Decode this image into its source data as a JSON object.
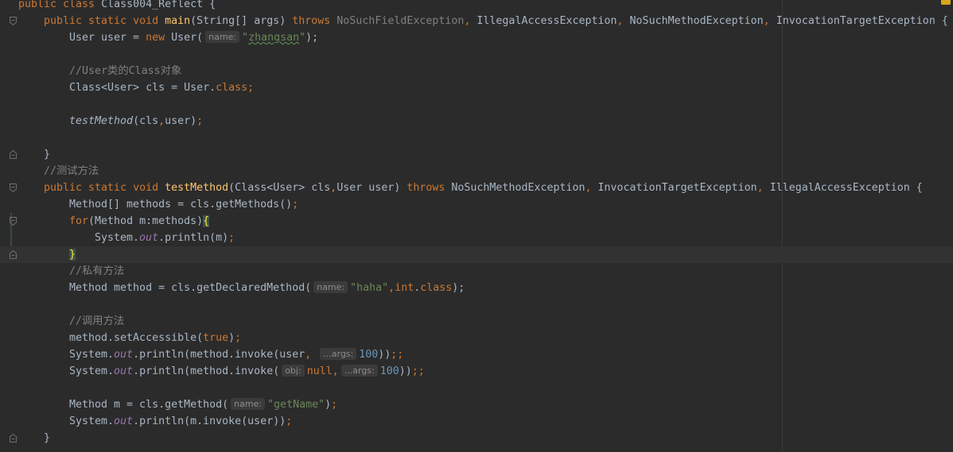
{
  "editor": {
    "language": "java",
    "theme": "darcula",
    "colors": {
      "background": "#2b2b2b",
      "keyword": "#cc7832",
      "string": "#6a8759",
      "number": "#6897bb",
      "comment": "#808080",
      "method_declaration": "#ffc66d",
      "static_field": "#9876aa",
      "plain": "#a9b7c6",
      "matched_brace": "#ffef28"
    },
    "lines": [
      {
        "indent": 0,
        "fold": "none",
        "tokens": [
          {
            "t": "public class ",
            "c": "kw"
          },
          {
            "t": "Class004_Reflect {",
            "c": "plain"
          }
        ]
      },
      {
        "indent": 1,
        "fold": "open",
        "tokens": [
          {
            "t": "public static void ",
            "c": "kw"
          },
          {
            "t": "main",
            "c": "fn"
          },
          {
            "t": "(String[] args) ",
            "c": "plain"
          },
          {
            "t": "throws ",
            "c": "kw"
          },
          {
            "t": "NoSuchFieldException",
            "c": "unused"
          },
          {
            "t": ", ",
            "c": "kw"
          },
          {
            "t": "IllegalAccessException",
            "c": "plain"
          },
          {
            "t": ", ",
            "c": "kw"
          },
          {
            "t": "NoSuchMethodException",
            "c": "plain"
          },
          {
            "t": ", ",
            "c": "kw"
          },
          {
            "t": "InvocationTargetException {",
            "c": "plain"
          }
        ]
      },
      {
        "indent": 2,
        "fold": "none",
        "tokens": [
          {
            "t": "User user = ",
            "c": "plain"
          },
          {
            "t": "new ",
            "c": "kw"
          },
          {
            "t": "User(",
            "c": "plain"
          },
          {
            "t": "name:",
            "c": "hint"
          },
          {
            "t": "\"",
            "c": "str"
          },
          {
            "t": "zhangsan",
            "c": "str-warn"
          },
          {
            "t": "\"",
            "c": "str"
          },
          {
            "t": ");",
            "c": "plain"
          }
        ]
      },
      {
        "indent": 0,
        "fold": "none",
        "tokens": []
      },
      {
        "indent": 2,
        "fold": "none",
        "tokens": [
          {
            "t": "//User类的Class对象",
            "c": "cmt"
          }
        ]
      },
      {
        "indent": 2,
        "fold": "none",
        "tokens": [
          {
            "t": "Class<User> cls = User.",
            "c": "plain"
          },
          {
            "t": "class;",
            "c": "kw"
          }
        ]
      },
      {
        "indent": 0,
        "fold": "none",
        "tokens": []
      },
      {
        "indent": 2,
        "fold": "none",
        "tokens": [
          {
            "t": "testMethod",
            "c": "static"
          },
          {
            "t": "(cls",
            "c": "plain"
          },
          {
            "t": ",",
            "c": "kw"
          },
          {
            "t": "user)",
            "c": "plain"
          },
          {
            "t": ";",
            "c": "kw"
          }
        ]
      },
      {
        "indent": 0,
        "fold": "none",
        "tokens": []
      },
      {
        "indent": 1,
        "fold": "close",
        "tokens": [
          {
            "t": "}",
            "c": "plain"
          }
        ]
      },
      {
        "indent": 1,
        "fold": "none",
        "tokens": [
          {
            "t": "//测试方法",
            "c": "cmt"
          }
        ]
      },
      {
        "indent": 1,
        "fold": "open",
        "tokens": [
          {
            "t": "public static void ",
            "c": "kw"
          },
          {
            "t": "testMethod",
            "c": "fn"
          },
          {
            "t": "(Class<User> cls",
            "c": "plain"
          },
          {
            "t": ",",
            "c": "kw"
          },
          {
            "t": "User user) ",
            "c": "plain"
          },
          {
            "t": "throws ",
            "c": "kw"
          },
          {
            "t": "NoSuchMethodException",
            "c": "plain"
          },
          {
            "t": ", ",
            "c": "kw"
          },
          {
            "t": "InvocationTargetException",
            "c": "plain"
          },
          {
            "t": ", ",
            "c": "kw"
          },
          {
            "t": "IllegalAccessException {",
            "c": "plain"
          }
        ]
      },
      {
        "indent": 2,
        "fold": "none",
        "tokens": [
          {
            "t": "Method[] methods = cls.getMethods()",
            "c": "plain"
          },
          {
            "t": ";",
            "c": "kw"
          }
        ]
      },
      {
        "indent": 2,
        "fold": "open",
        "tokens": [
          {
            "t": "for",
            "c": "kw"
          },
          {
            "t": "(Method m:methods)",
            "c": "plain"
          },
          {
            "t": "{",
            "c": "brace"
          }
        ]
      },
      {
        "indent": 3,
        "fold": "none",
        "tokens": [
          {
            "t": "System.",
            "c": "plain"
          },
          {
            "t": "out",
            "c": "field"
          },
          {
            "t": ".println(m)",
            "c": "plain"
          },
          {
            "t": ";",
            "c": "kw"
          }
        ]
      },
      {
        "indent": 2,
        "fold": "close",
        "current": true,
        "tokens": [
          {
            "t": "}",
            "c": "brace"
          }
        ]
      },
      {
        "indent": 2,
        "fold": "none",
        "tokens": [
          {
            "t": "//私有方法",
            "c": "cmt"
          }
        ]
      },
      {
        "indent": 2,
        "fold": "none",
        "tokens": [
          {
            "t": "Method method = cls.getDeclaredMethod(",
            "c": "plain"
          },
          {
            "t": "name:",
            "c": "hint"
          },
          {
            "t": "\"haha\"",
            "c": "str"
          },
          {
            "t": ",",
            "c": "kw"
          },
          {
            "t": "int",
            "c": "kw"
          },
          {
            "t": ".",
            "c": "plain"
          },
          {
            "t": "class",
            "c": "kw"
          },
          {
            "t": ");",
            "c": "plain"
          }
        ]
      },
      {
        "indent": 0,
        "fold": "none",
        "tokens": []
      },
      {
        "indent": 2,
        "fold": "none",
        "tokens": [
          {
            "t": "//调用方法",
            "c": "cmt"
          }
        ]
      },
      {
        "indent": 2,
        "fold": "none",
        "tokens": [
          {
            "t": "method.setAccessible(",
            "c": "plain"
          },
          {
            "t": "true",
            "c": "kw"
          },
          {
            "t": ")",
            "c": "plain"
          },
          {
            "t": ";",
            "c": "kw"
          }
        ]
      },
      {
        "indent": 2,
        "fold": "none",
        "tokens": [
          {
            "t": "System.",
            "c": "plain"
          },
          {
            "t": "out",
            "c": "field"
          },
          {
            "t": ".println(method.invoke(user",
            "c": "plain"
          },
          {
            "t": ",",
            "c": "kw"
          },
          {
            "t": " ",
            "c": "plain"
          },
          {
            "t": "...args:",
            "c": "hint"
          },
          {
            "t": "100",
            "c": "num"
          },
          {
            "t": "))",
            "c": "plain"
          },
          {
            "t": ";;",
            "c": "kw"
          }
        ]
      },
      {
        "indent": 2,
        "fold": "none",
        "tokens": [
          {
            "t": "System.",
            "c": "plain"
          },
          {
            "t": "out",
            "c": "field"
          },
          {
            "t": ".println(method.invoke(",
            "c": "plain"
          },
          {
            "t": "obj:",
            "c": "hint"
          },
          {
            "t": "null",
            "c": "kw"
          },
          {
            "t": ",",
            "c": "kw"
          },
          {
            "t": "...args:",
            "c": "hint"
          },
          {
            "t": "100",
            "c": "num"
          },
          {
            "t": "))",
            "c": "plain"
          },
          {
            "t": ";;",
            "c": "kw"
          }
        ]
      },
      {
        "indent": 0,
        "fold": "none",
        "tokens": []
      },
      {
        "indent": 2,
        "fold": "none",
        "tokens": [
          {
            "t": "Method m = cls.getMethod(",
            "c": "plain"
          },
          {
            "t": "name:",
            "c": "hint"
          },
          {
            "t": "\"getName\"",
            "c": "str"
          },
          {
            "t": ")",
            "c": "plain"
          },
          {
            "t": ";",
            "c": "kw"
          }
        ]
      },
      {
        "indent": 2,
        "fold": "none",
        "tokens": [
          {
            "t": "System.",
            "c": "plain"
          },
          {
            "t": "out",
            "c": "field"
          },
          {
            "t": ".println(m.invoke(user))",
            "c": "plain"
          },
          {
            "t": ";",
            "c": "kw"
          }
        ]
      },
      {
        "indent": 1,
        "fold": "close",
        "tokens": [
          {
            "t": "}",
            "c": "plain"
          }
        ]
      }
    ]
  }
}
